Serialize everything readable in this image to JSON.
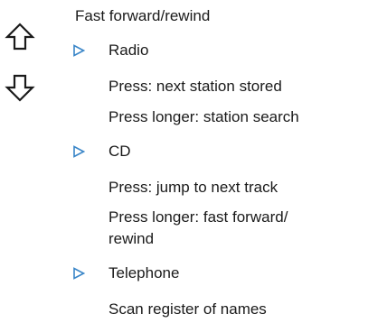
{
  "heading": "Fast forward/rewind",
  "icons": {
    "up": "arrow-up-outline-icon",
    "down": "arrow-down-outline-icon",
    "bullet": "triangle-right-outline-icon"
  },
  "colors": {
    "bullet": "#3a86c8",
    "icon_stroke": "#1a1a1a",
    "text": "#1a1a1a"
  },
  "sections": [
    {
      "label": "Radio",
      "lines": [
        "Press: next station stored",
        "Press longer: station search"
      ]
    },
    {
      "label": "CD",
      "lines": [
        "Press: jump to next track",
        "Press longer: fast forward/",
        "rewind"
      ]
    },
    {
      "label": "Telephone",
      "lines": [
        "Scan register of names"
      ]
    }
  ]
}
